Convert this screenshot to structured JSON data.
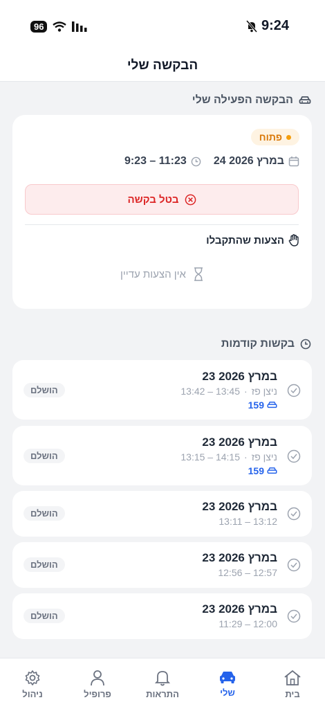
{
  "status_bar": {
    "battery": "96",
    "time": "9:24"
  },
  "header": {
    "title": "הבקשה שלי"
  },
  "active_section": {
    "title": "הבקשה הפעילה שלי"
  },
  "active_request": {
    "status": "פתוח",
    "date": "24 במרץ 2026",
    "time_range": "9:23 – 11:23",
    "cancel_label": "בטל בקשה",
    "offers_title": "הצעות שהתקבלו",
    "no_offers": "אין הצעות עדיין"
  },
  "previous_section": {
    "title": "בקשות קודמות"
  },
  "previous_requests": [
    {
      "date": "23 במרץ 2026",
      "time": "13:42 – 13:45",
      "person": "ניצן פז",
      "price": "159",
      "status": "הושלם"
    },
    {
      "date": "23 במרץ 2026",
      "time": "13:15 – 14:15",
      "person": "ניצן פז",
      "price": "159",
      "status": "הושלם"
    },
    {
      "date": "23 במרץ 2026",
      "time": "13:11 – 13:12",
      "status": "הושלם"
    },
    {
      "date": "23 במרץ 2026",
      "time": "12:56 – 12:57",
      "status": "הושלם"
    },
    {
      "date": "23 במרץ 2026",
      "time": "11:29 – 12:00",
      "status": "הושלם"
    }
  ],
  "nav": [
    {
      "label": "בית",
      "icon": "home-icon"
    },
    {
      "label": "שלי",
      "icon": "car-icon",
      "active": true
    },
    {
      "label": "התראות",
      "icon": "bell-icon"
    },
    {
      "label": "פרופיל",
      "icon": "user-icon"
    },
    {
      "label": "ניהול",
      "icon": "gear-icon"
    }
  ],
  "colors": {
    "accent": "#2563eb",
    "danger": "#dc2626",
    "pending": "#f59e0b"
  }
}
